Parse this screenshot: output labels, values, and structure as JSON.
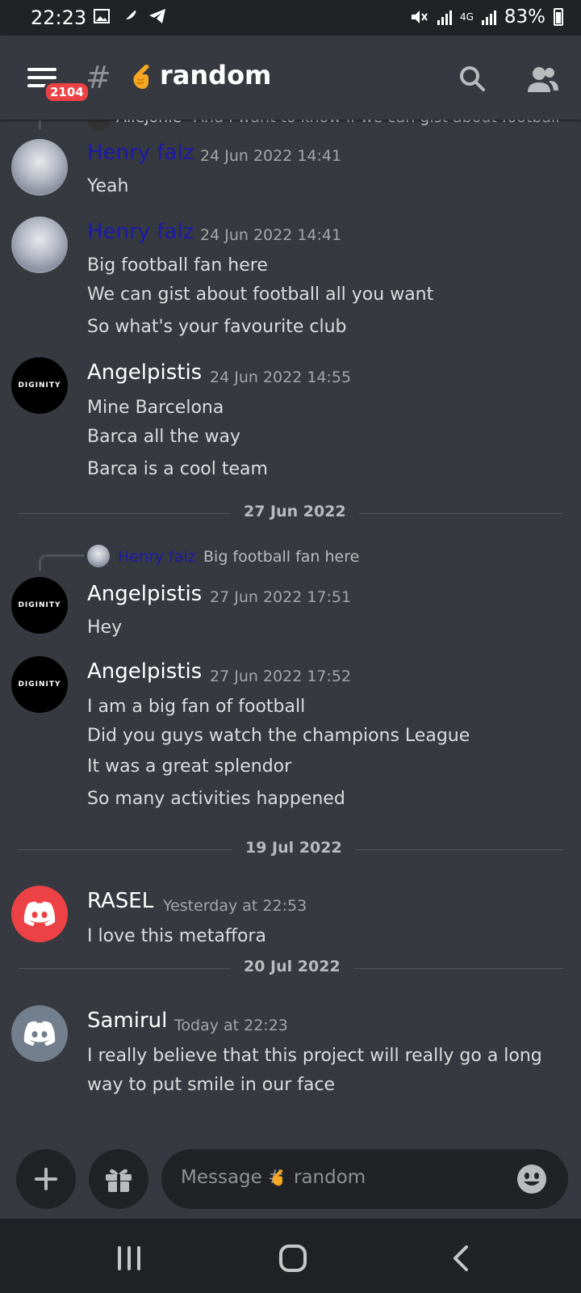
{
  "status_bar": {
    "time": "22:23",
    "battery": "83%",
    "network": "4G"
  },
  "header": {
    "unread_badge": "2104",
    "channel_name": "random",
    "channel_emoji": "pointing-hand-emoji"
  },
  "messages": {
    "partial_reply": {
      "author": "Allejonie",
      "text": "And I want to know if we can gist about football"
    },
    "m1": {
      "author": "Henry falz",
      "timestamp": "24 Jun 2022 14:41",
      "lines": [
        "Yeah"
      ]
    },
    "m2": {
      "author": "Henry falz",
      "timestamp": "24 Jun 2022 14:41",
      "lines": [
        "Big football fan here",
        "We can gist about football all you want",
        "So what's your favourite club"
      ]
    },
    "m3": {
      "author": "Angelpistis",
      "timestamp": "24 Jun 2022 14:55",
      "lines": [
        "Mine Barcelona",
        "Barca all the way",
        "Barca is a cool team"
      ]
    },
    "divider1": "27 Jun 2022",
    "m4_reply": {
      "author": "Henry falz",
      "text": "Big football fan here"
    },
    "m4": {
      "author": "Angelpistis",
      "timestamp": "27 Jun 2022 17:51",
      "lines": [
        "Hey"
      ]
    },
    "m5": {
      "author": "Angelpistis",
      "timestamp": "27 Jun 2022 17:52",
      "lines": [
        "I am a big fan of football",
        "Did you guys watch the champions League",
        "It was a great splendor",
        "So many activities happened"
      ]
    },
    "divider2": "19 Jul 2022",
    "m6": {
      "author": "RASEL",
      "timestamp": "Yesterday at 22:53",
      "lines": [
        "I love this metaffora"
      ]
    },
    "divider3": "20 Jul 2022",
    "m7": {
      "author": "Samirul",
      "timestamp": "Today at 22:23",
      "lines": [
        "I really believe that this project will really go a long",
        "way to put smile in our face"
      ]
    }
  },
  "composer": {
    "placeholder_prefix": "Message #",
    "placeholder_channel": "random"
  },
  "avatar_text": {
    "angel": "DIGINITY"
  },
  "colors": {
    "background": "#36393f",
    "dark": "#202225",
    "username_blue": "#1d1aa8",
    "discord_red": "#ed4245",
    "discord_grey": "#747f8d",
    "emoji_orange": "#f5a623"
  }
}
